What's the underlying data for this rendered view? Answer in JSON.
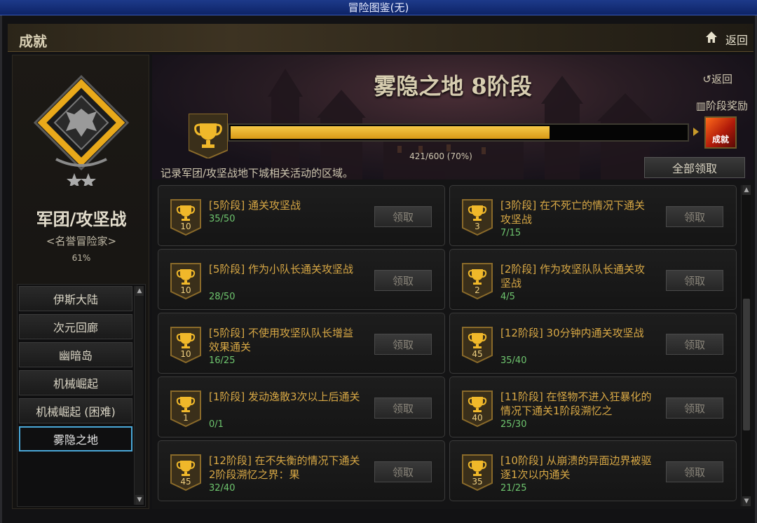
{
  "window": {
    "title": "冒险图鉴(无)"
  },
  "header": {
    "section_title": "成就",
    "back_label": "返回"
  },
  "category": {
    "title": "军团/攻坚战",
    "subtitle": "<名誉冒险家>",
    "percent": "61%"
  },
  "nav": {
    "items": [
      {
        "label": "伊斯大陆"
      },
      {
        "label": "次元回廊"
      },
      {
        "label": "幽暗岛"
      },
      {
        "label": "机械崛起"
      },
      {
        "label": "机械崛起 (困难)"
      },
      {
        "label": "雾隐之地"
      }
    ],
    "active_index": 5
  },
  "stage": {
    "title": "雾隐之地 8阶段",
    "back_link": "返回",
    "reward_link": "阶段奖励",
    "reward_icon_text": "成就",
    "progress_current": 421,
    "progress_total": 600,
    "progress_text": "421/600 (70%)",
    "progress_fraction": 0.7017
  },
  "description": "记录军团/攻坚战地下城相关活动的区域。",
  "claim_all_label": "全部领取",
  "achievements": [
    {
      "title": "[5阶段] 通关攻坚战",
      "progress": "35/50",
      "points": "10",
      "claim": "领取"
    },
    {
      "title": "[3阶段] 在不死亡的情况下通关攻坚战",
      "progress": "7/15",
      "points": "3",
      "claim": "领取"
    },
    {
      "title": "[5阶段] 作为小队长通关攻坚战",
      "progress": "28/50",
      "points": "10",
      "claim": "领取"
    },
    {
      "title": "[2阶段] 作为攻坚队队长通关攻坚战",
      "progress": "4/5",
      "points": "2",
      "claim": "领取"
    },
    {
      "title": "[5阶段] 不使用攻坚队队长增益效果通关",
      "progress": "16/25",
      "points": "10",
      "claim": "领取"
    },
    {
      "title": "[12阶段] 30分钟内通关攻坚战",
      "progress": "35/40",
      "points": "45",
      "claim": "领取"
    },
    {
      "title": "[1阶段] 发动逸散3次以上后通关",
      "progress": "0/1",
      "points": "1",
      "claim": "领取"
    },
    {
      "title": "[11阶段] 在怪物不进入狂暴化的情况下通关1阶段溯忆之",
      "progress": "25/30",
      "points": "40",
      "claim": "领取"
    },
    {
      "title": "[12阶段] 在不失衡的情况下通关2阶段溯忆之界：果",
      "progress": "32/40",
      "points": "45",
      "claim": "领取"
    },
    {
      "title": "[10阶段] 从崩溃的异面边界被驱逐1次以内通关",
      "progress": "21/25",
      "points": "35",
      "claim": "领取"
    }
  ],
  "colors": {
    "accent_gold": "#e8b32a",
    "progress_green": "#6ec56e",
    "active_border": "#4aa8d8"
  }
}
